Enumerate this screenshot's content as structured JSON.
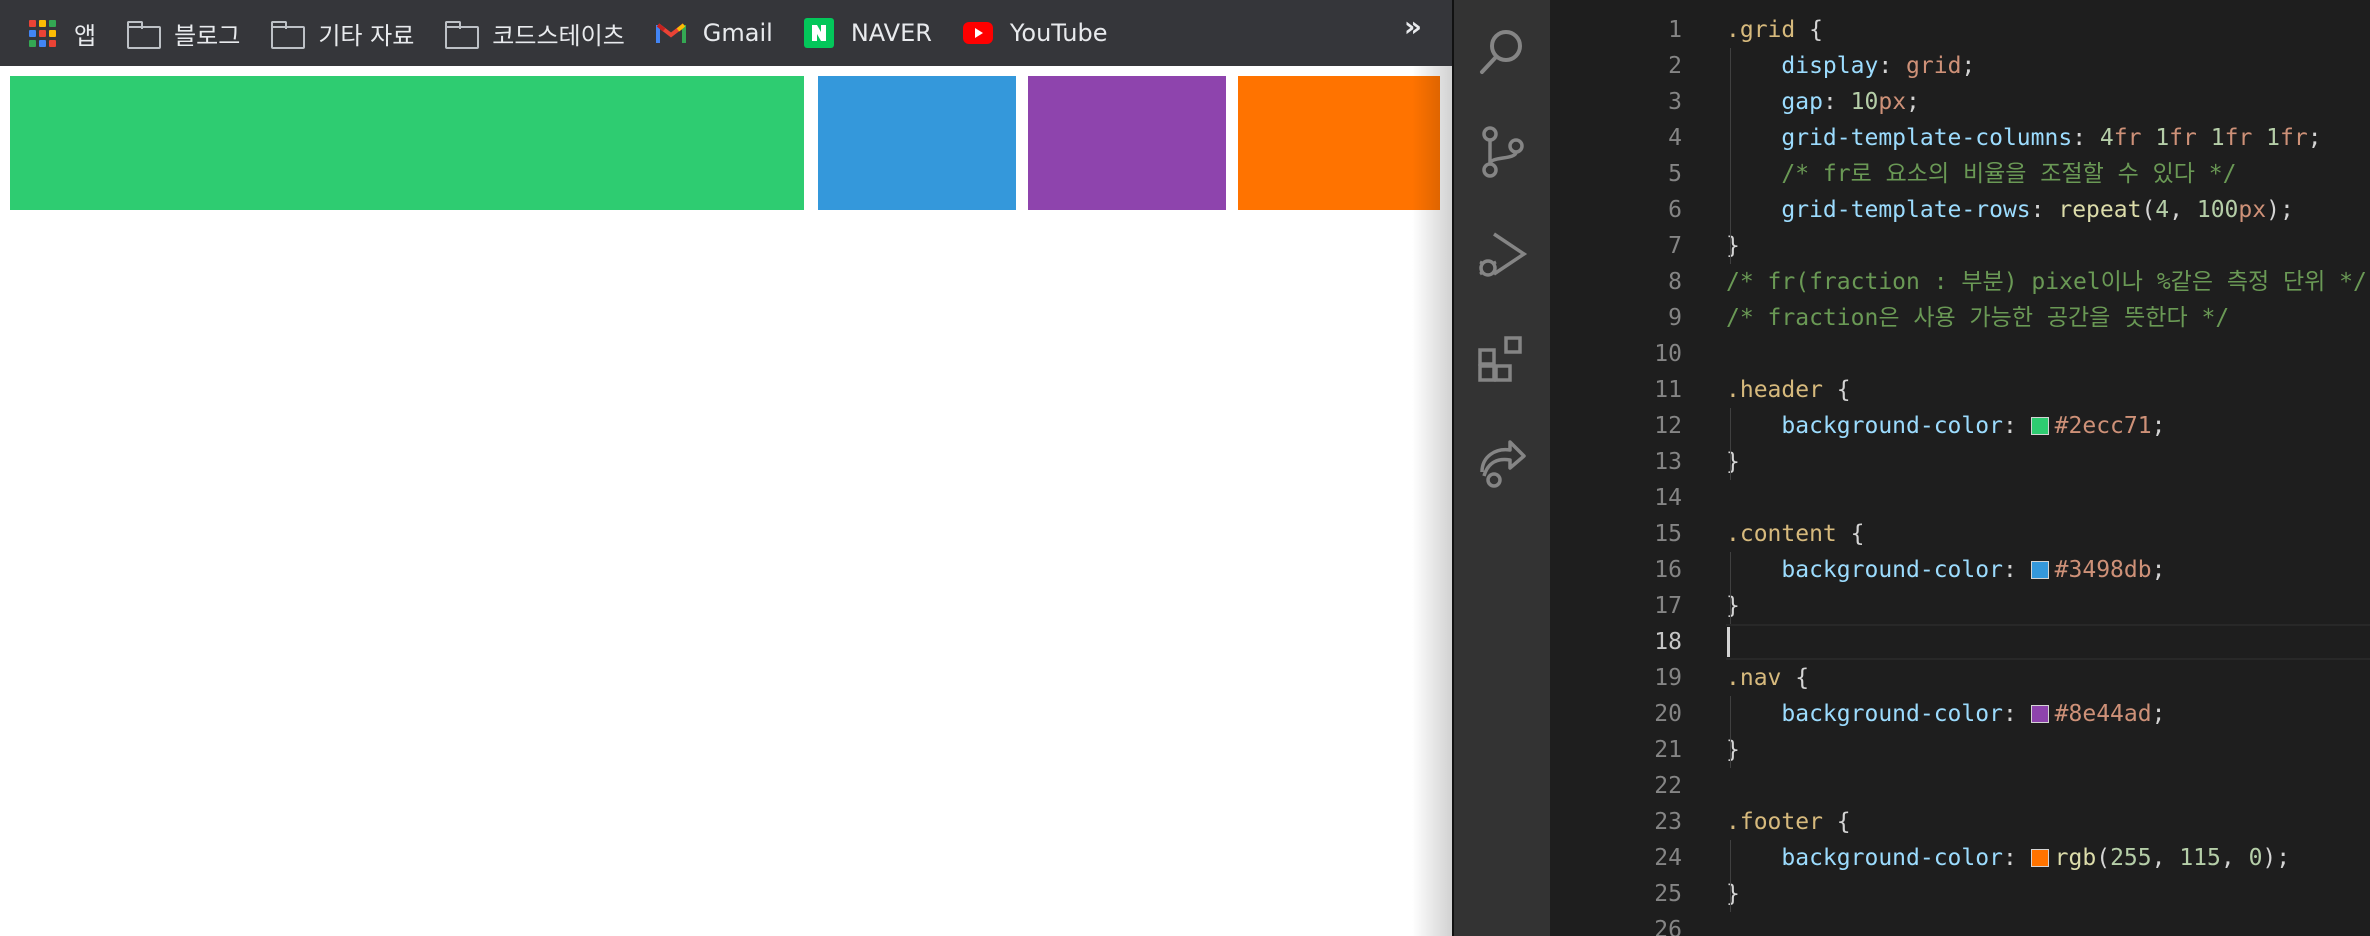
{
  "bookmarks": {
    "items": [
      {
        "label": "앱",
        "icon": "apps-grid-icon"
      },
      {
        "label": "블로그",
        "icon": "folder-icon"
      },
      {
        "label": "기타 자료",
        "icon": "folder-icon"
      },
      {
        "label": "코드스테이츠",
        "icon": "folder-icon"
      },
      {
        "label": "Gmail",
        "icon": "gmail-icon"
      },
      {
        "label": "NAVER",
        "icon": "naver-icon"
      },
      {
        "label": "YouTube",
        "icon": "youtube-icon"
      }
    ],
    "overflow": "»"
  },
  "preview": {
    "cells": [
      {
        "name": "header",
        "color": "#2ecc71"
      },
      {
        "name": "content",
        "color": "#3498db"
      },
      {
        "name": "nav",
        "color": "#8e44ad"
      },
      {
        "name": "footer",
        "color": "#ff7300"
      }
    ]
  },
  "editor": {
    "activity": [
      "search-icon",
      "source-control-icon",
      "run-debug-icon",
      "extensions-icon",
      "live-share-icon"
    ],
    "current_line": 18,
    "lines": [
      {
        "n": "1",
        "t": ".grid {"
      },
      {
        "n": "2",
        "t": "    display: grid;"
      },
      {
        "n": "3",
        "t": "    gap: 10px;"
      },
      {
        "n": "4",
        "t": "    grid-template-columns: 4fr 1fr 1fr 1fr;"
      },
      {
        "n": "5",
        "t": "    /* fr로 요소의 비율을 조절할 수 있다 */"
      },
      {
        "n": "6",
        "t": "    grid-template-rows: repeat(4, 100px);"
      },
      {
        "n": "7",
        "t": "}"
      },
      {
        "n": "8",
        "t": "/* fr(fraction : 부분) pixel이나 %같은 측정 단위 */"
      },
      {
        "n": "9",
        "t": "/* fraction은 사용 가능한 공간을 뜻한다 */"
      },
      {
        "n": "10",
        "t": ""
      },
      {
        "n": "11",
        "t": ".header {"
      },
      {
        "n": "12",
        "t": "    background-color: #2ecc71;"
      },
      {
        "n": "13",
        "t": "}"
      },
      {
        "n": "14",
        "t": ""
      },
      {
        "n": "15",
        "t": ".content {"
      },
      {
        "n": "16",
        "t": "    background-color: #3498db;"
      },
      {
        "n": "17",
        "t": "}"
      },
      {
        "n": "18",
        "t": ""
      },
      {
        "n": "19",
        "t": ".nav {"
      },
      {
        "n": "20",
        "t": "    background-color: #8e44ad;"
      },
      {
        "n": "21",
        "t": "}"
      },
      {
        "n": "22",
        "t": ""
      },
      {
        "n": "23",
        "t": ".footer {"
      },
      {
        "n": "24",
        "t": "    background-color: rgb(255, 115, 0);"
      },
      {
        "n": "25",
        "t": "}"
      },
      {
        "n": "26",
        "t": ""
      }
    ]
  }
}
